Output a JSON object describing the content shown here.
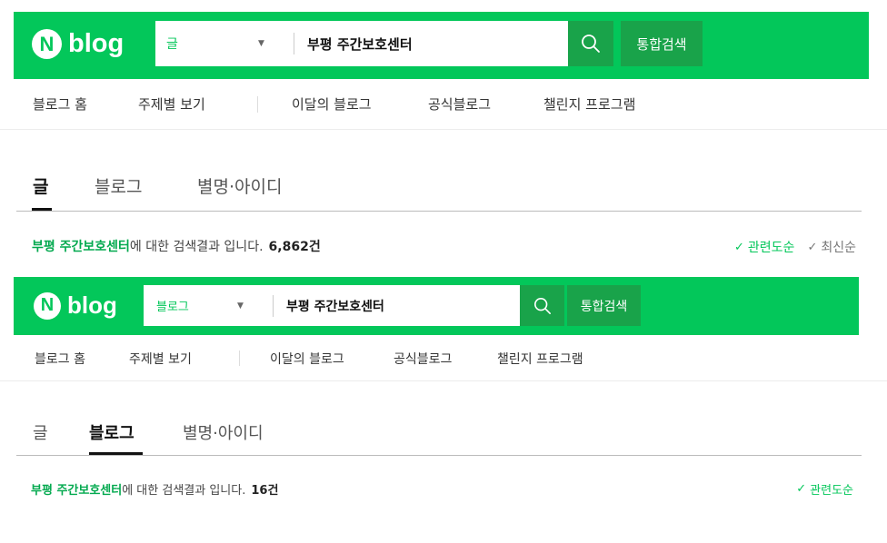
{
  "colors": {
    "brand": "#03c75a",
    "brand_dark": "#19a34a",
    "keyword": "#03a94f"
  },
  "panels": [
    {
      "logo": {
        "n": "N",
        "text": "blog"
      },
      "search": {
        "category": "글",
        "query": "부평 주간보호센터",
        "button_icon": "search-icon",
        "unified_label": "통합검색"
      },
      "subnav": [
        "블로그 홈",
        "주제별 보기",
        "이달의 블로그",
        "공식블로그",
        "챌린지 프로그램"
      ],
      "tabs": [
        "글",
        "블로그",
        "별명·아이디"
      ],
      "active_tab": "글",
      "result": {
        "keyword": "부평 주간보호센터",
        "suffix": "에 대한 검색결과 입니다.",
        "count": "6,862건"
      },
      "sort": [
        {
          "label": "관련도순",
          "check": "✓",
          "active": true
        },
        {
          "label": "최신순",
          "check": "✓",
          "active": false
        }
      ]
    },
    {
      "logo": {
        "n": "N",
        "text": "blog"
      },
      "search": {
        "category": "블로그",
        "query": "부평 주간보호센터",
        "button_icon": "search-icon",
        "unified_label": "통합검색"
      },
      "subnav": [
        "블로그 홈",
        "주제별 보기",
        "이달의 블로그",
        "공식블로그",
        "챌린지 프로그램"
      ],
      "tabs": [
        "글",
        "블로그",
        "별명·아이디"
      ],
      "active_tab": "블로그",
      "result": {
        "keyword": "부평 주간보호센터",
        "suffix": "에 대한 검색결과 입니다.",
        "count": "16건"
      },
      "sort": [
        {
          "label": "관련도순",
          "check": "✓",
          "active": true
        }
      ]
    }
  ]
}
